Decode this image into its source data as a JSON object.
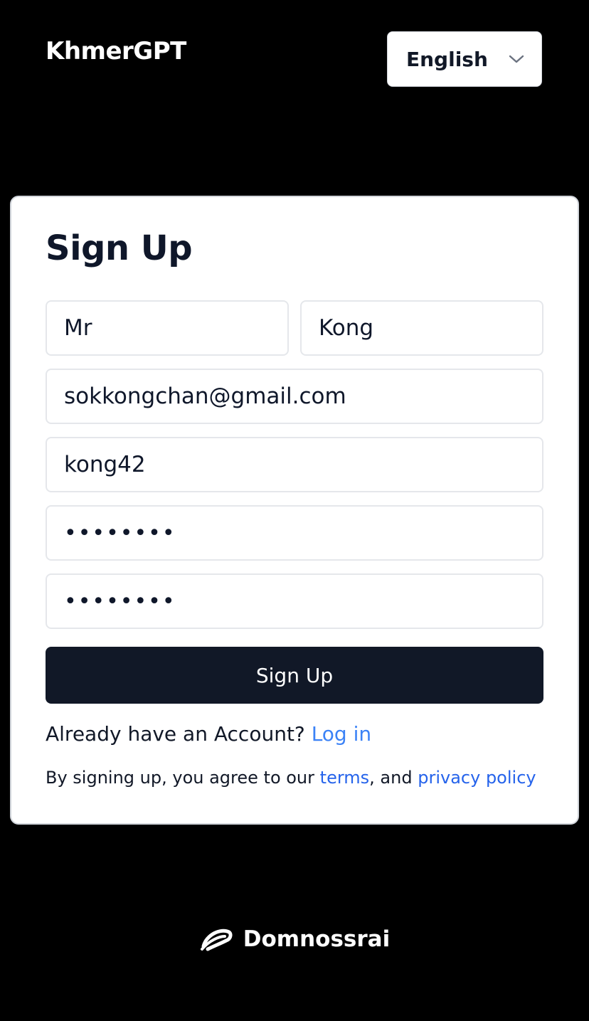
{
  "header": {
    "brand": "KhmerGPT",
    "language": {
      "selected": "English",
      "icon": "chevron-down-icon"
    }
  },
  "signup": {
    "title": "Sign Up",
    "first_name": "Mr",
    "last_name": "Kong",
    "email": "sokkongchan@gmail.com",
    "username": "kong42",
    "password": "••••••••",
    "confirm_password": "••••••••",
    "submit_label": "Sign Up",
    "login_prompt": "Already have an Account?",
    "login_link": "Log in",
    "terms_prefix": "By signing up, you agree to our",
    "terms_link": "terms",
    "terms_middle": ", and",
    "privacy_link": "privacy policy"
  },
  "footer": {
    "logo_icon": "domnossrai-logo-icon",
    "name": "Domnossrai"
  },
  "colors": {
    "background": "#000000",
    "card": "#ffffff",
    "button": "#111827",
    "link": "#3b82f6",
    "text": "#0f172a"
  }
}
